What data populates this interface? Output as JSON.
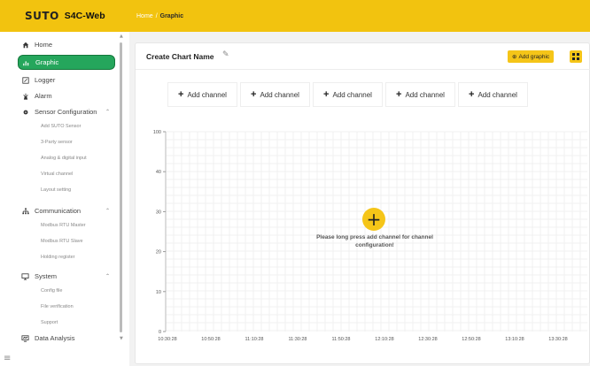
{
  "brand": {
    "logo": "SUTO",
    "app_name": "S4C-Web"
  },
  "breadcrumb": {
    "home": "Home",
    "separator": "/",
    "current": "Graphic"
  },
  "sidebar": {
    "items": [
      {
        "label": "Home",
        "icon": "home-icon"
      },
      {
        "label": "Graphic",
        "icon": "chart-icon",
        "active": true
      },
      {
        "label": "Logger",
        "icon": "logger-icon"
      },
      {
        "label": "Alarm",
        "icon": "alarm-icon"
      },
      {
        "label": "Sensor Configuration",
        "icon": "sensor-icon",
        "expanded": true,
        "children": [
          "Add SUTO Sensor",
          "3-Party sensor",
          "Analog & digital input",
          "Virtual channel",
          "Layout setting"
        ]
      },
      {
        "label": "Communication",
        "icon": "network-icon",
        "expanded": true,
        "children": [
          "Modbus RTU Master",
          "Modbus RTU Slave",
          "Holding register"
        ]
      },
      {
        "label": "System",
        "icon": "monitor-icon",
        "expanded": true,
        "children": [
          "Config file",
          "File verification",
          "Support"
        ]
      },
      {
        "label": "Data Analysis",
        "icon": "data-analysis-icon"
      }
    ]
  },
  "main": {
    "chart_name": "Create Chart Name",
    "add_graphic_label": "Add graphic",
    "channels": [
      "Add channel",
      "Add channel",
      "Add channel",
      "Add channel",
      "Add channel"
    ],
    "empty_message_line1": "Please long press add channel for channel",
    "empty_message_line2": "configuration!"
  },
  "colors": {
    "brand_yellow": "#f2c30f",
    "active_green": "#25a65c"
  },
  "chart_data": {
    "type": "line",
    "y_ticks": [
      "100",
      "40",
      "30",
      "20",
      "10",
      "0"
    ],
    "x_ticks": [
      "10:30:28",
      "10:50:28",
      "11:10:28",
      "11:30:28",
      "11:50:28",
      "12:10:28",
      "12:30:28",
      "12:50:28",
      "13:10:28",
      "13:30:28",
      "13:50:28"
    ],
    "series": [],
    "grid": true
  }
}
